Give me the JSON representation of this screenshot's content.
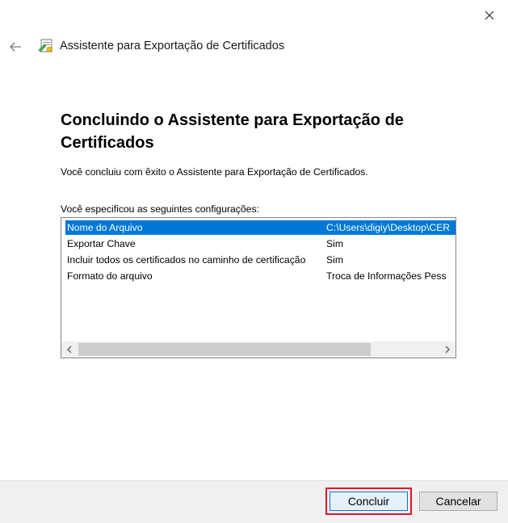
{
  "window": {
    "title": "Assistente para Exportação de Certificados",
    "close_icon": "close-icon",
    "back_icon": "back-arrow-icon",
    "wizard_icon": "certificate-wizard-icon"
  },
  "main": {
    "heading": "Concluindo o Assistente para Exportação de Certificados",
    "description": "Você concluiu com êxito o Assistente para Exportação de Certificados.",
    "list_label": "Você especificou as seguintes configurações:",
    "settings": [
      {
        "name": "Nome do Arquivo",
        "value": "C:\\Users\\digiy\\Desktop\\CER"
      },
      {
        "name": "Exportar Chave",
        "value": "Sim"
      },
      {
        "name": "Incluir todos os certificados no caminho de certificação",
        "value": "Sim"
      },
      {
        "name": "Formato do arquivo",
        "value": "Troca de Informações Pess"
      }
    ],
    "selected_index": 0
  },
  "footer": {
    "finish_label": "Concluir",
    "cancel_label": "Cancelar"
  },
  "colors": {
    "selection": "#0078d7",
    "highlight_border": "#e81123"
  }
}
